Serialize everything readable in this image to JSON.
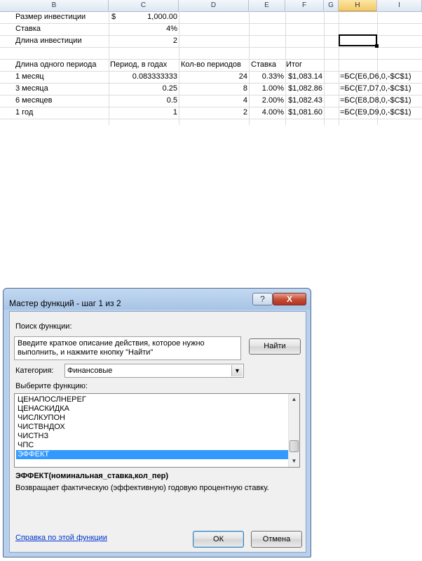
{
  "sheet": {
    "columns": [
      "B",
      "C",
      "D",
      "E",
      "F",
      "G",
      "H",
      "I"
    ],
    "selected_column": "H",
    "rows": [
      [
        "Размер инвестиции",
        "$",
        "1,000.00",
        "",
        "",
        "",
        "",
        ""
      ],
      [
        "Ставка",
        "",
        "4%",
        "",
        "",
        "",
        "",
        ""
      ],
      [
        "Длина инвестиции",
        "",
        "2",
        "",
        "",
        "",
        "",
        ""
      ],
      [
        "",
        "",
        "",
        "",
        "",
        "",
        "",
        ""
      ],
      [
        "Длина одного периода",
        "Период, в годах",
        "Кол-во периодов",
        "Ставка",
        "Итог",
        "",
        "",
        ""
      ],
      [
        "1 месяц",
        "0.083333333",
        "24",
        "0.33%",
        "$1,083.14",
        "",
        "=БС(E6,D6,0,-$C$1)",
        ""
      ],
      [
        "3 месяца",
        "0.25",
        "8",
        "1.00%",
        "$1,082.86",
        "",
        "=БС(E7,D7,0,-$C$1)",
        ""
      ],
      [
        "6 месяцев",
        "0.5",
        "4",
        "2.00%",
        "$1,082.43",
        "",
        "=БС(E8,D8,0,-$C$1)",
        ""
      ],
      [
        "1 год",
        "1",
        "2",
        "4.00%",
        "$1,081.60",
        "",
        "=БС(E9,D9,0,-$C$1)",
        ""
      ]
    ]
  },
  "dialog": {
    "title": "Мастер функций - шаг 1 из 2",
    "help_glyph": "?",
    "close_glyph": "X",
    "search_label": "Поиск функции:",
    "search_text_line1": "Введите краткое описание действия, которое нужно",
    "search_text_line2": "выполнить, и нажмите кнопку \"Найти\"",
    "find_button": "Найти",
    "category_label": "Категория:",
    "category_value": "Финансовые",
    "select_function_label": "Выберите функцию:",
    "functions": [
      "ЦЕНАПОСЛНЕРЕГ",
      "ЦЕНАСКИДКА",
      "ЧИСЛКУПОН",
      "ЧИСТВНДОХ",
      "ЧИСТНЗ",
      "ЧПС",
      "ЭФФЕКТ"
    ],
    "selected_function_index": 6,
    "signature": "ЭФФЕКТ(номинальная_ставка,кол_пер)",
    "description": "Возвращает фактическую (эффективную) годовую процентную ставку.",
    "help_link": "Справка по этой функции",
    "ok_button": "ОК",
    "cancel_button": "Отмена"
  }
}
